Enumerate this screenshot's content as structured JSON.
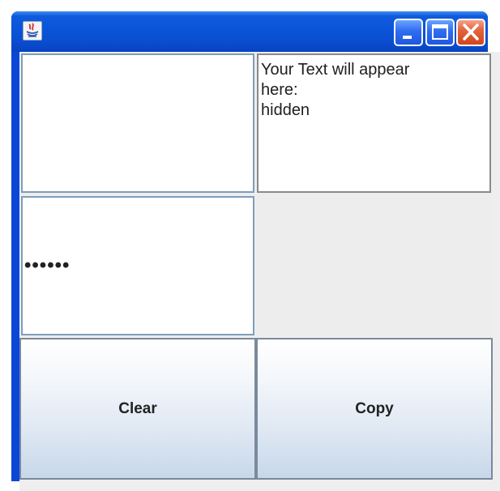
{
  "window": {
    "title": "",
    "icon": "java-icon",
    "controls": [
      "minimize-icon",
      "maximize-icon",
      "close-icon"
    ],
    "title_bar_color": "#0a4fd0",
    "close_color": "#d2461b"
  },
  "text_field": {
    "value": ""
  },
  "text_area": {
    "value": "Your Text will appear\nhere:\nhidden"
  },
  "password_field": {
    "value": "••••••"
  },
  "buttons": {
    "clear_label": "Clear",
    "copy_label": "Copy"
  }
}
